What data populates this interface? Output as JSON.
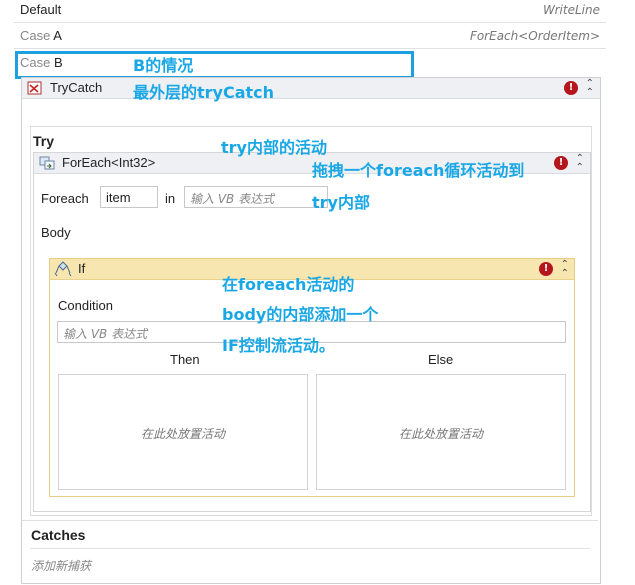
{
  "cases": [
    {
      "label": "Default",
      "value": "",
      "activity": "WriteLine"
    },
    {
      "label": "Case",
      "value": "A",
      "activity": "ForEach<OrderItem>"
    },
    {
      "label": "Case",
      "value": "B",
      "activity": ""
    }
  ],
  "trycatch": {
    "title": "TryCatch",
    "try_label": "Try",
    "catches_label": "Catches",
    "add_catch": "添加新捕获"
  },
  "foreach": {
    "title": "ForEach<Int32>",
    "foreach_label": "Foreach",
    "item_value": "item",
    "in_label": "in",
    "expr_placeholder": "输入 VB 表达式",
    "body_label": "Body"
  },
  "if_activity": {
    "title": "If",
    "condition_label": "Condition",
    "condition_placeholder": "输入 VB 表达式",
    "then_label": "Then",
    "else_label": "Else",
    "drop_hint": "在此处放置活动"
  },
  "annotations": {
    "case_b": "B的情况",
    "outer_trycatch": "最外层的tryCatch",
    "try_inner": "try内部的活动",
    "drag_foreach_1": "拖拽一个foreach循环活动到",
    "drag_foreach_2": "try内部",
    "add_if_1": "在foreach活动的",
    "add_if_2": "body的内部添加一个",
    "add_if_3": "IF控制流活动。"
  },
  "colors": {
    "accent": "#1ca0e0",
    "error": "#b5161b",
    "if_header": "#f8e6b0",
    "if_border": "#e6cf85"
  }
}
